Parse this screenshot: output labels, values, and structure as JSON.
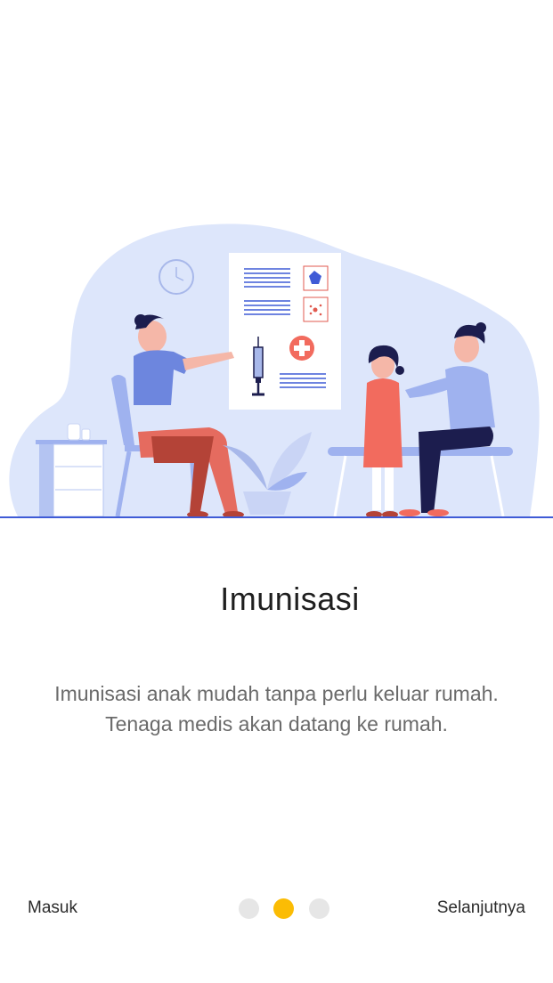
{
  "onboarding": {
    "title": "Imunisasi",
    "description_line1": "Imunisasi anak mudah tanpa perlu keluar rumah.",
    "description_line2": "Tenaga medis akan datang ke rumah.",
    "illustration_icon": "immunization-scene-illustration"
  },
  "nav": {
    "login_label": "Masuk",
    "next_label": "Selanjutnya",
    "page_indicator": {
      "total": 3,
      "active": 2
    }
  },
  "colors": {
    "accent": "#fbbc04",
    "inactive_dot": "#e6e6e6",
    "primary_blue": "#3f5bd6",
    "blob": "#dde6fb"
  }
}
